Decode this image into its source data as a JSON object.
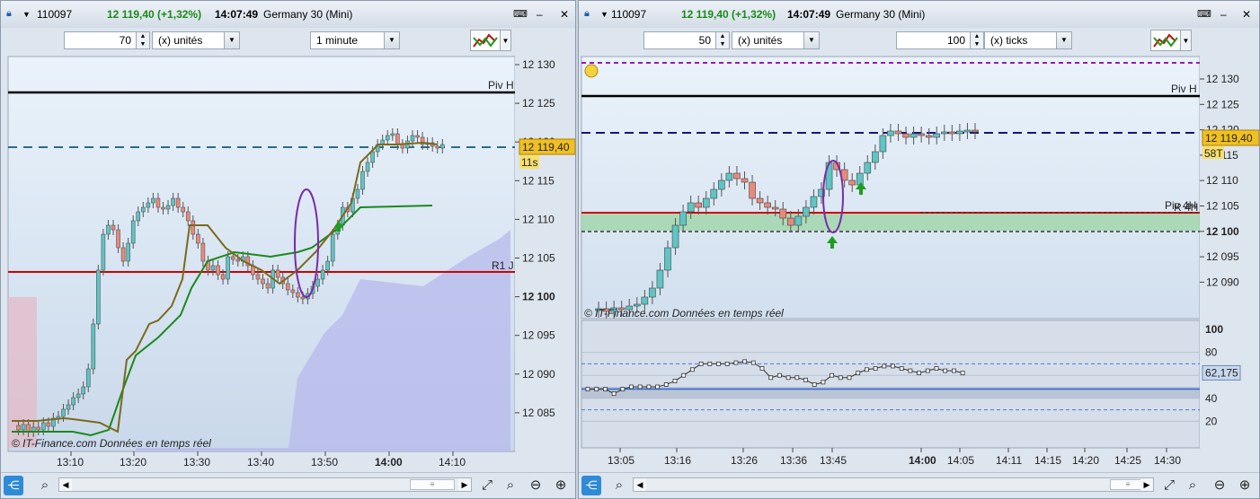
{
  "windows": [
    {
      "id": "left",
      "title": {
        "code": "110097",
        "price": "12 119,40 (+1,32%)",
        "time": "14:07:49",
        "name": "Germany 30 (Mini)"
      },
      "toolbar": {
        "qty": "70",
        "unit": "(x) unités",
        "period": "1 minute"
      },
      "price_axis": [
        "12 130",
        "12 125",
        "12 120",
        "12 115",
        "12 110",
        "12 105",
        "12 100",
        "12 095",
        "12 090",
        "12 085"
      ],
      "bold_tick": "12 100",
      "current_price": "12 119,40",
      "countdown": "11s",
      "level_labels": {
        "pivot_high": "Piv H",
        "r1": "R1 J"
      },
      "time_axis": [
        "13:10",
        "13:20",
        "13:30",
        "13:40",
        "13:50",
        "14:00",
        "14:10"
      ],
      "bold_time": "14:00",
      "watermark": "© IT-Finance.com Données en temps réel"
    },
    {
      "id": "right",
      "title": {
        "code": "110097",
        "price": "12 119,40 (+1,32%)",
        "time": "14:07:49",
        "name": "Germany 30 (Mini)"
      },
      "toolbar": {
        "qty": "50",
        "unit": "(x) unités",
        "ticks_qty": "100",
        "ticks_unit": "(x) ticks"
      },
      "price_axis": [
        "12 130",
        "12 125",
        "12 120",
        "12 115",
        "12 110",
        "12 105",
        "12 100",
        "12 095",
        "12 090"
      ],
      "bold_tick": "12 100",
      "current_price": "12 119,40",
      "countdown": "58T",
      "level_labels": {
        "pivot_high": "Piv H",
        "pivot_4h": "Piv 4H",
        "r4h": "R 4H"
      },
      "osc_axis": [
        "100",
        "80",
        "60",
        "40",
        "20"
      ],
      "osc_value": "62,175",
      "time_axis": [
        "13:05",
        "13:16",
        "13:26",
        "13:36",
        "13:45",
        "14:00",
        "14:05",
        "14:11",
        "14:15",
        "14:20",
        "14:25",
        "14:30"
      ],
      "bold_time": "14:00",
      "watermark": "© IT-Finance.com Données en temps réel"
    }
  ],
  "colors": {
    "bull": "#5fc4c4",
    "bear": "#e88a7a",
    "price_tag": "#f0c020",
    "pivot": "#000000",
    "r1": "#d00000",
    "purple": "#7a2aa8"
  },
  "icons": [
    "bell-icon",
    "share-icon",
    "zoom-fit-icon",
    "zoom-out-icon",
    "zoom-in-icon",
    "search-cursor-icon",
    "indicator-icon"
  ]
}
